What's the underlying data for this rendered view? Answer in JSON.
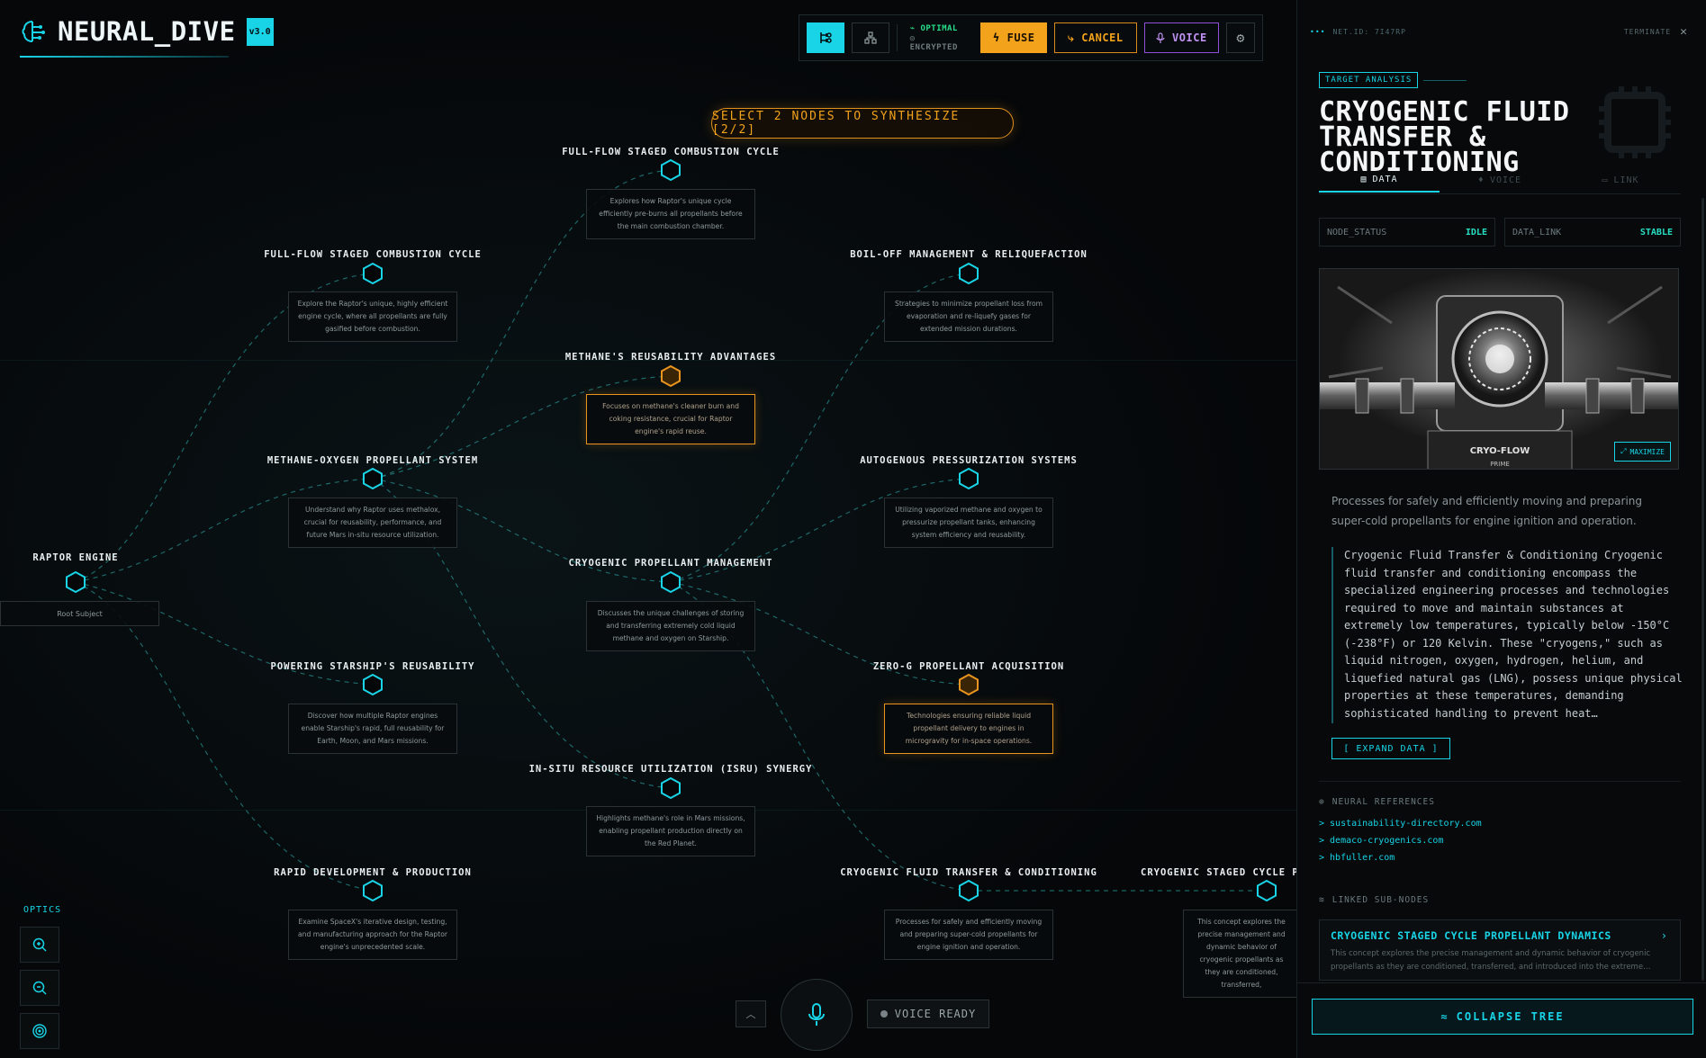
{
  "brand": {
    "title": "NEURAL_DIVE",
    "version": "v3.0"
  },
  "toolbar": {
    "status_line1": "OPTIMAL",
    "status_line2": "ENCRYPTED",
    "fuse_label": "FUSE",
    "cancel_label": "CANCEL",
    "voice_label": "VOICE"
  },
  "banner": "SELECT 2 NODES TO SYNTHESIZE [2/2]",
  "colors": {
    "accent": "#18d4e6",
    "selected": "#e8941e",
    "ok": "#27e08a",
    "voice": "#8f4fd8"
  },
  "root": {
    "title": "RAPTOR ENGINE",
    "subtitle": "Root Subject"
  },
  "nodes": [
    {
      "title": "FULL-FLOW STAGED COMBUSTION CYCLE",
      "desc": "Explores how Raptor's unique cycle efficiently pre-burns all propellants before the main combustion chamber.",
      "selected": false
    },
    {
      "title": "FULL-FLOW STAGED COMBUSTION CYCLE",
      "desc": "Explore the Raptor's unique, highly efficient engine cycle, where all propellants are fully gasified before combustion.",
      "selected": false
    },
    {
      "title": "BOIL-OFF MANAGEMENT & RELIQUEFACTION",
      "desc": "Strategies to minimize propellant loss from evaporation and re-liquefy gases for extended mission durations.",
      "selected": false
    },
    {
      "title": "METHANE'S REUSABILITY ADVANTAGES",
      "desc": "Focuses on methane's cleaner burn and coking resistance, crucial for Raptor engine's rapid reuse.",
      "selected": true
    },
    {
      "title": "METHANE-OXYGEN PROPELLANT SYSTEM",
      "desc": "Understand why Raptor uses methalox, crucial for reusability, performance, and future Mars in-situ resource utilization.",
      "selected": false
    },
    {
      "title": "AUTOGENOUS PRESSURIZATION SYSTEMS",
      "desc": "Utilizing vaporized methane and oxygen to pressurize propellant tanks, enhancing system efficiency and reusability.",
      "selected": false
    },
    {
      "title": "CRYOGENIC PROPELLANT MANAGEMENT",
      "desc": "Discusses the unique challenges of storing and transferring extremely cold liquid methane and oxygen on Starship.",
      "selected": false
    },
    {
      "title": "POWERING STARSHIP'S REUSABILITY",
      "desc": "Discover how multiple Raptor engines enable Starship's rapid, full reusability for Earth, Moon, and Mars missions.",
      "selected": false
    },
    {
      "title": "ZERO-G PROPELLANT ACQUISITION",
      "desc": "Technologies ensuring reliable liquid propellant delivery to engines in microgravity for in-space operations.",
      "selected": true
    },
    {
      "title": "IN-SITU RESOURCE UTILIZATION (ISRU) SYNERGY",
      "desc": "Highlights methane's role in Mars missions, enabling propellant production directly on the Red Planet.",
      "selected": false
    },
    {
      "title": "RAPID DEVELOPMENT & PRODUCTION",
      "desc": "Examine SpaceX's iterative design, testing, and manufacturing approach for the Raptor engine's unprecedented scale.",
      "selected": false
    },
    {
      "title": "CRYOGENIC FLUID TRANSFER & CONDITIONING",
      "desc": "Processes for safely and efficiently moving and preparing super-cold propellants for engine ignition and operation.",
      "selected": false
    },
    {
      "title": "CRYOGENIC STAGED CYCLE PRO",
      "desc": "This concept explores the precise management and dynamic behavior of cryogenic propellants as they are conditioned, transferred,",
      "selected": false
    }
  ],
  "optics": {
    "label": "OPTICS"
  },
  "voice_status": "VOICE READY",
  "panel": {
    "net_id": "NET.ID: 7I47RP",
    "terminate": "TERMINATE",
    "chip": "TARGET ANALYSIS",
    "title": "CRYOGENIC FLUID TRANSFER & CONDITIONING",
    "tabs": [
      "DATA",
      "VOICE",
      "LINK"
    ],
    "node_status_key": "NODE_STATUS",
    "node_status_val": "IDLE",
    "data_link_key": "DATA_LINK",
    "data_link_val": "STABLE",
    "image_label": "CRYO-FLOW",
    "image_label2": "PRIME",
    "maximize": "MAXIMIZE",
    "summary": "Processes for safely and efficiently moving and preparing super-cold propellants for engine ignition and operation.",
    "body": "Cryogenic Fluid Transfer & Conditioning Cryogenic fluid transfer and conditioning encompass the specialized engineering processes and technologies required to move and maintain substances at extremely low temperatures, typically below -150°C (-238°F) or 120 Kelvin. These \"cryogens,\" such as liquid nitrogen, oxygen, hydrogen, helium, and liquefied natural gas (LNG), possess unique physical properties at these temperatures, demanding sophisticated handling to prevent heat…",
    "expand": "[ EXPAND DATA ]",
    "refs_head": "NEURAL REFERENCES",
    "refs": [
      "sustainability-directory.com",
      "demaco-cryogenics.com",
      "hbfuller.com"
    ],
    "linked_head": "LINKED SUB-NODES",
    "linked_title": "CRYOGENIC STAGED CYCLE PROPELLANT DYNAMICS",
    "linked_desc": "This concept explores the precise management and dynamic behavior of cryogenic propellants as they are conditioned, transferred, and introduced into the extreme…",
    "collapse": "COLLAPSE TREE"
  }
}
